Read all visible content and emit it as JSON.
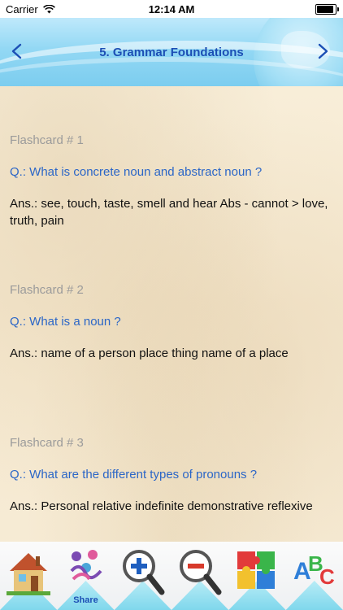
{
  "status_bar": {
    "carrier": "Carrier",
    "time": "12:14 AM"
  },
  "header": {
    "title": "5. Grammar Foundations"
  },
  "cards": [
    {
      "label": "Flashcard # 1",
      "question": "Q.: What is concrete noun and abstract noun ?",
      "answer": "Ans.: see, touch, taste, smell and hear Abs - cannot > love, truth, pain"
    },
    {
      "label": "Flashcard # 2",
      "question": "Q.: What is a noun ?",
      "answer": "Ans.: name of a person place thing name of a place"
    },
    {
      "label": "Flashcard # 3",
      "question": "Q.: What are the different types of pronouns ?",
      "answer": "Ans.: Personal relative indefinite demonstrative reflexive"
    }
  ],
  "toolbar": {
    "items": [
      {
        "icon": "home-icon",
        "label": ""
      },
      {
        "icon": "share-icon",
        "label": "Share"
      },
      {
        "icon": "zoom-in-icon",
        "label": ""
      },
      {
        "icon": "zoom-out-icon",
        "label": ""
      },
      {
        "icon": "puzzle-icon",
        "label": ""
      },
      {
        "icon": "abc-icon",
        "label": ""
      }
    ]
  },
  "colors": {
    "question": "#2b66c7",
    "label": "#9b9b9b",
    "title": "#1c4fb5",
    "header": "#93d8f4"
  }
}
